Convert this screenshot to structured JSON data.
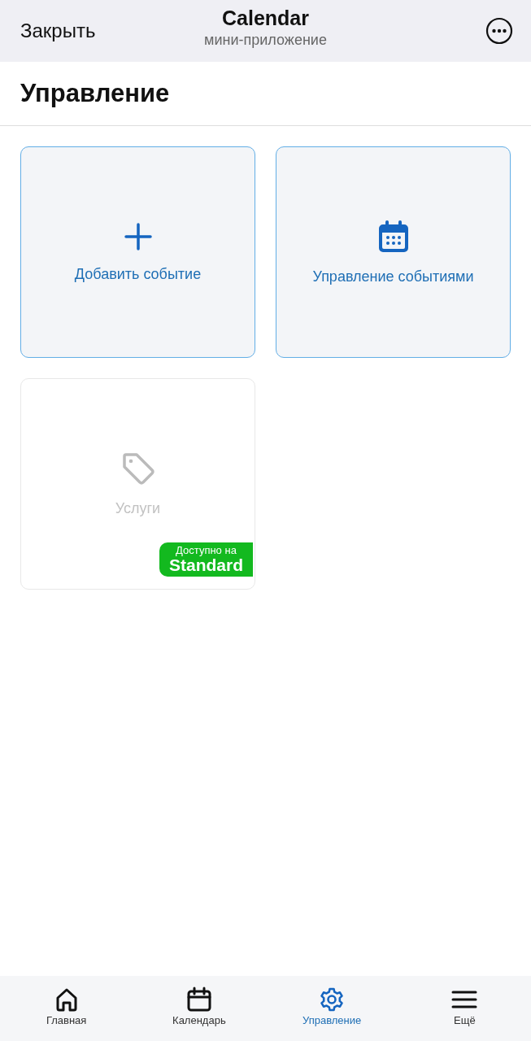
{
  "header": {
    "close": "Закрыть",
    "title": "Calendar",
    "subtitle": "мини-приложение"
  },
  "page_title": "Управление",
  "tiles": [
    {
      "label": "Добавить событие",
      "disabled": false
    },
    {
      "label": "Управление событиями",
      "disabled": false
    },
    {
      "label": "Услуги",
      "disabled": true,
      "badge": {
        "line1": "Доступно на",
        "line2": "Standard"
      }
    }
  ],
  "nav": [
    {
      "label": "Главная",
      "selected": false
    },
    {
      "label": "Календарь",
      "selected": false
    },
    {
      "label": "Управление",
      "selected": true
    },
    {
      "label": "Ещё",
      "selected": false
    }
  ]
}
